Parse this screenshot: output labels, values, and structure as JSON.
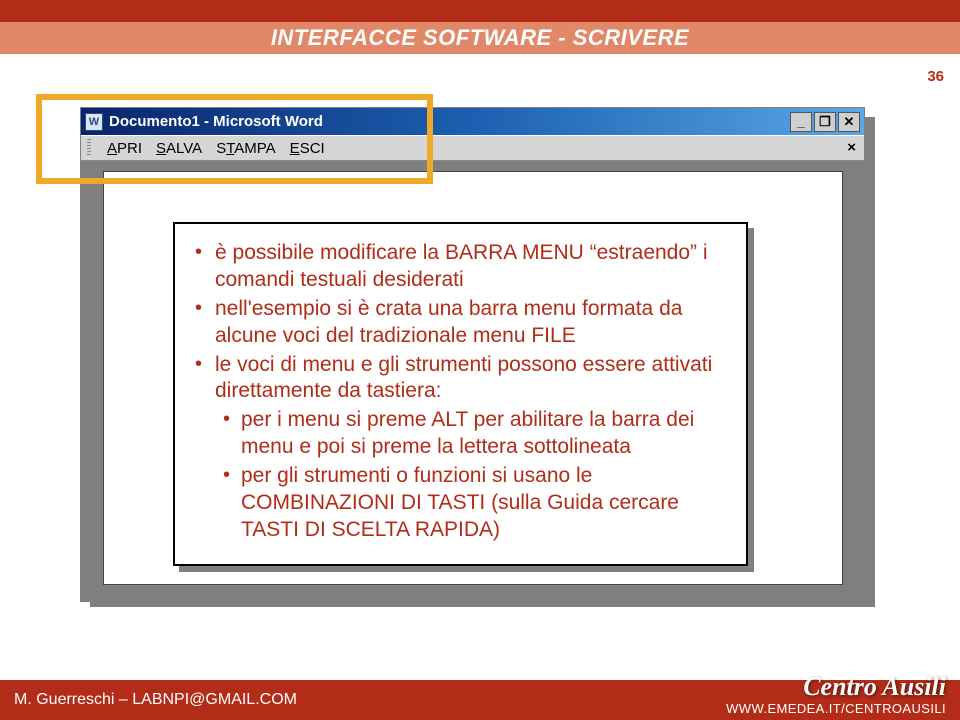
{
  "header": {
    "title": "INTERFACCE SOFTWARE - SCRIVERE"
  },
  "page_number": "36",
  "word_window": {
    "doc_icon_text": "W",
    "title": "Documento1 - Microsoft Word",
    "btn_min": "_",
    "btn_restore": "❐",
    "btn_close": "✕",
    "menu": {
      "apri_pre": "A",
      "apri_rest": "PRI",
      "salva_pre": "S",
      "salva_rest": "ALVA",
      "stampa_pre": "S",
      "stampa_u": "T",
      "stampa_rest": "AMPA",
      "esci_pre": "E",
      "esci_rest": "SCI",
      "inner_close": "×"
    }
  },
  "callout": {
    "li1": "è possibile modificare la BARRA MENU “estraendo” i comandi testuali desiderati",
    "li2": "nell'esempio si è crata una barra menu formata da alcune voci del tradizionale menu FILE",
    "li3": "le voci di menu e gli strumenti possono essere attivati direttamente da tastiera:",
    "li3a": "per i menu si preme ALT per abilitare la barra dei menu e poi si preme la lettera sottolineata",
    "li3b": "per gli strumenti o funzioni si usano le COMBINAZIONI DI TASTI (sulla Guida cercare TASTI DI SCELTA RAPIDA)"
  },
  "footer": {
    "author": "M. Guerreschi – LABNPI@GMAIL.COM",
    "logo": "Centro Ausili",
    "url": "WWW.EMEDEA.IT/CENTROAUSILI"
  }
}
